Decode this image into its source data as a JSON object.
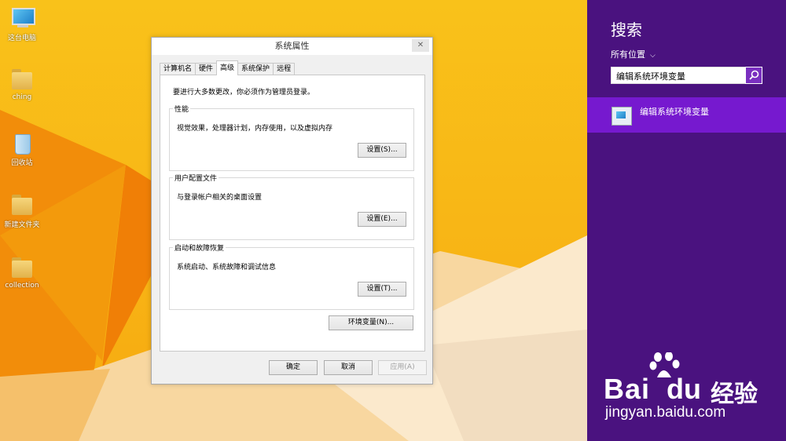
{
  "desktop": {
    "icons": [
      {
        "label": "这台电脑",
        "kind": "pc"
      },
      {
        "label": "ching",
        "kind": "folder"
      },
      {
        "label": "回收站",
        "kind": "bin"
      },
      {
        "label": "新建文件夹",
        "kind": "folder"
      },
      {
        "label": "collection",
        "kind": "folder"
      }
    ]
  },
  "dialog": {
    "title": "系统属性",
    "close_glyph": "✕",
    "tabs": [
      "计算机名",
      "硬件",
      "高级",
      "系统保护",
      "远程"
    ],
    "active_tab": "高级",
    "admin_note": "要进行大多数更改，你必须作为管理员登录。",
    "groups": {
      "performance": {
        "legend": "性能",
        "desc": "视觉效果，处理器计划，内存使用，以及虚拟内存",
        "button": "设置(S)..."
      },
      "profiles": {
        "legend": "用户配置文件",
        "desc": "与登录帐户相关的桌面设置",
        "button": "设置(E)..."
      },
      "startup": {
        "legend": "启动和故障恢复",
        "desc": "系统启动、系统故障和调试信息",
        "button": "设置(T)..."
      }
    },
    "env_button": "环境变量(N)...",
    "ok": "确定",
    "cancel": "取消",
    "apply": "应用(A)"
  },
  "charm": {
    "title": "搜索",
    "scope": "所有位置",
    "scope_chevron": "⌵",
    "search_value": "编辑系统环境变量",
    "result_label": "编辑系统环境变量"
  },
  "watermark": {
    "bai": "Bai",
    "du": "du",
    "cn": "经验",
    "url": "jingyan.baidu.com"
  },
  "colors": {
    "desktop_orange": "#f8b415",
    "charm_purple": "#4a127f",
    "result_highlight": "#7619cf"
  }
}
